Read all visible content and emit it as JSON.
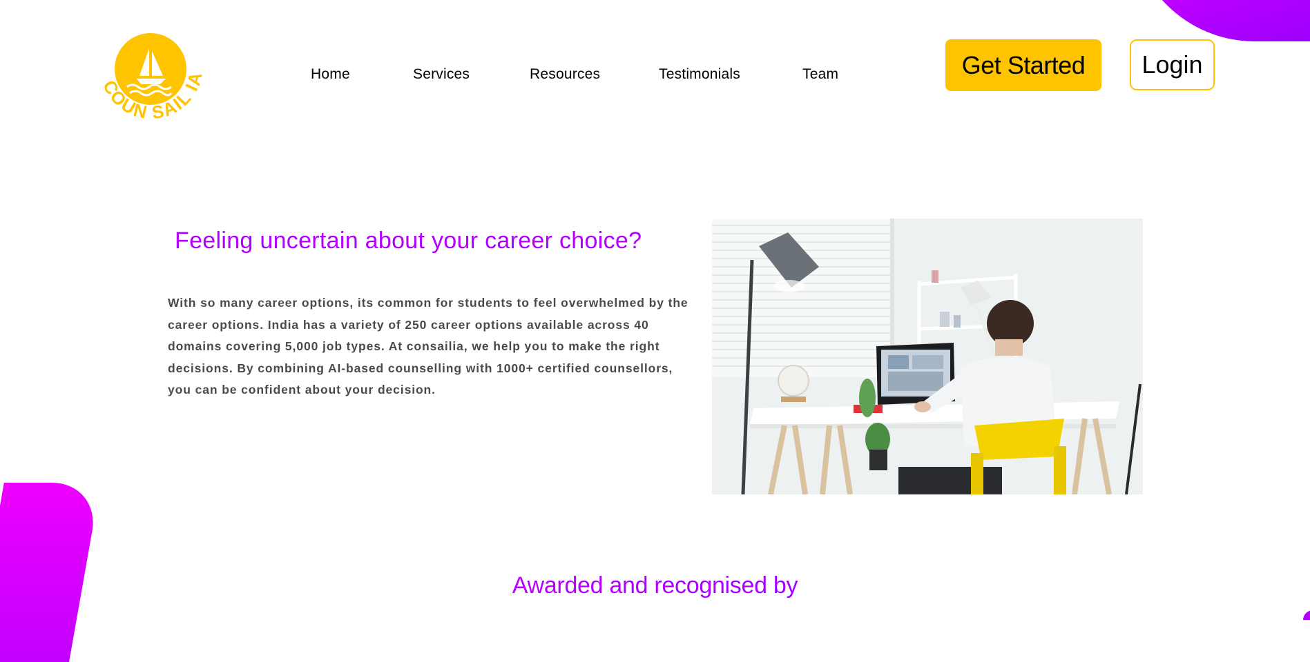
{
  "brand": {
    "logo_text": "COUN SAIL IA",
    "colors": {
      "primary": "#ffc400",
      "accent": "#b200ff"
    }
  },
  "nav": {
    "items": [
      {
        "label": "Home"
      },
      {
        "label": "Services"
      },
      {
        "label": "Resources"
      },
      {
        "label": "Testimonials"
      },
      {
        "label": "Team"
      }
    ]
  },
  "header": {
    "get_started_label": "Get Started",
    "login_label": "Login"
  },
  "hero": {
    "title": "Feeling uncertain about your career choice?",
    "body": "With so many career options, its common for students to feel overwhelmed by the career options. India has a variety of 250 career options available across 40 domains covering 5,000 job types. At consailia, we help you to make the right decisions. By combining AI-based counselling with 1000+ certified counsellors, you can be confident about your decision."
  },
  "awards": {
    "title": "Awarded and recognised by"
  }
}
